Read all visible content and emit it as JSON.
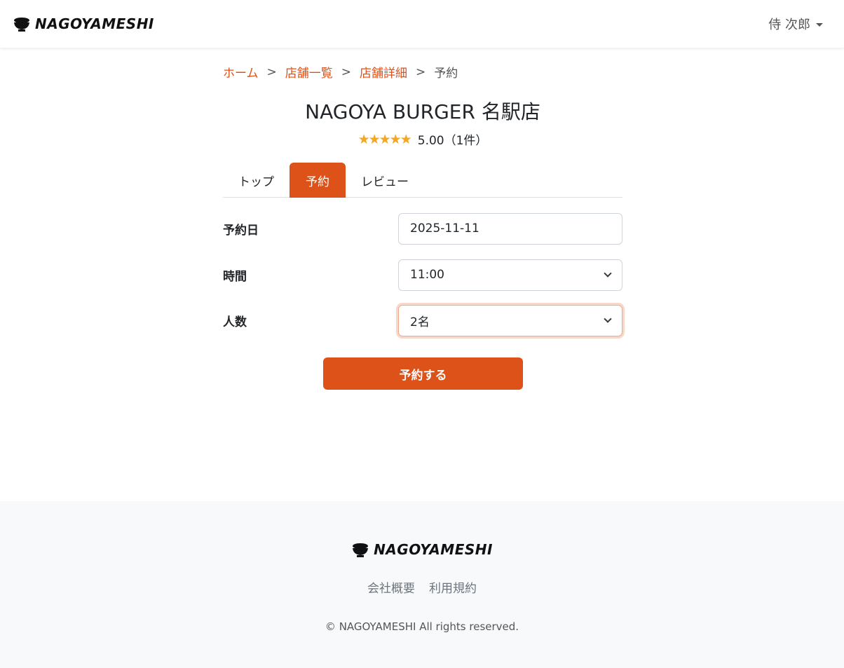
{
  "header": {
    "logo_text": "NAGOYAMESHI",
    "user_name": "侍 次郎"
  },
  "breadcrumb": {
    "home": "ホーム",
    "sep": ">",
    "list": "店舗一覧",
    "detail": "店舗詳細",
    "current": "予約"
  },
  "shop": {
    "name": "NAGOYA BURGER 名駅店",
    "stars": "★★★★★",
    "rating_value": 5,
    "rating_text": "5.00（1件）"
  },
  "tabs": [
    {
      "label": "トップ",
      "active": false
    },
    {
      "label": "予約",
      "active": true
    },
    {
      "label": "レビュー",
      "active": false
    }
  ],
  "form": {
    "date_label": "予約日",
    "date_value": "2025-11-11",
    "time_label": "時間",
    "time_value": "11:00",
    "people_label": "人数",
    "people_value": "2名",
    "submit_label": "予約する"
  },
  "footer": {
    "logo_text": "NAGOYAMESHI",
    "links": [
      "会社概要",
      "利用規約"
    ],
    "copyright": "© NAGOYAMESHI All rights reserved."
  },
  "colors": {
    "accent": "#dc5218",
    "star": "#f5a623",
    "footer_bg": "#f8f9fa"
  }
}
